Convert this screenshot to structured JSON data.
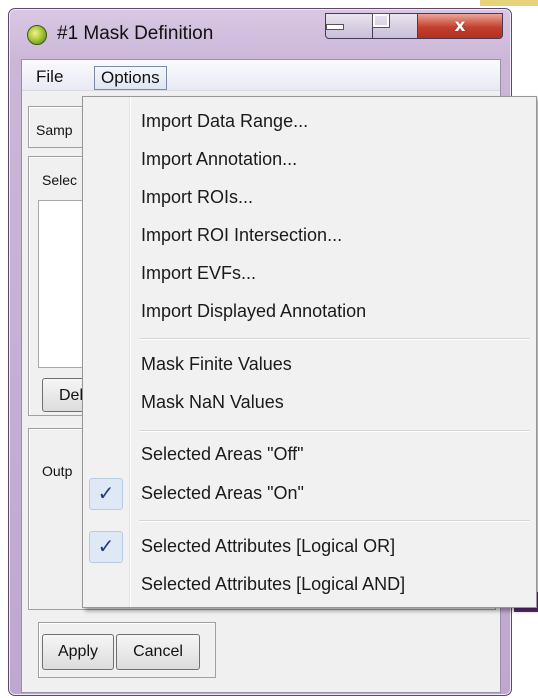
{
  "window": {
    "title": "#1 Mask Definition",
    "close_glyph": "x"
  },
  "menubar": {
    "file": "File",
    "options": "Options"
  },
  "dialog": {
    "sample_label": "Samp",
    "select_label": "Selec",
    "delete_label": "Del",
    "output_label": "Outp",
    "apply_label": "Apply",
    "cancel_label": "Cancel"
  },
  "options_menu": {
    "items": [
      {
        "label": "Import Data Range...",
        "checked": false
      },
      {
        "label": "Import Annotation...",
        "checked": false
      },
      {
        "label": "Import ROIs...",
        "checked": false
      },
      {
        "label": "Import ROI Intersection...",
        "checked": false
      },
      {
        "label": "Import EVFs...",
        "checked": false
      },
      {
        "label": "Import Displayed Annotation",
        "checked": false
      },
      {
        "label": "Mask Finite Values",
        "checked": false
      },
      {
        "label": "Mask NaN Values",
        "checked": false
      },
      {
        "label": "Selected Areas \"Off\"",
        "checked": false
      },
      {
        "label": "Selected Areas \"On\"",
        "checked": true
      },
      {
        "label": "Selected Attributes [Logical OR]",
        "checked": true
      },
      {
        "label": "Selected Attributes [Logical AND]",
        "checked": false
      }
    ],
    "check_glyph": "✓"
  },
  "colors": {
    "frame": "#cbb6d8",
    "close_button": "#c4402e",
    "check_highlight": "#dfe9f5"
  }
}
